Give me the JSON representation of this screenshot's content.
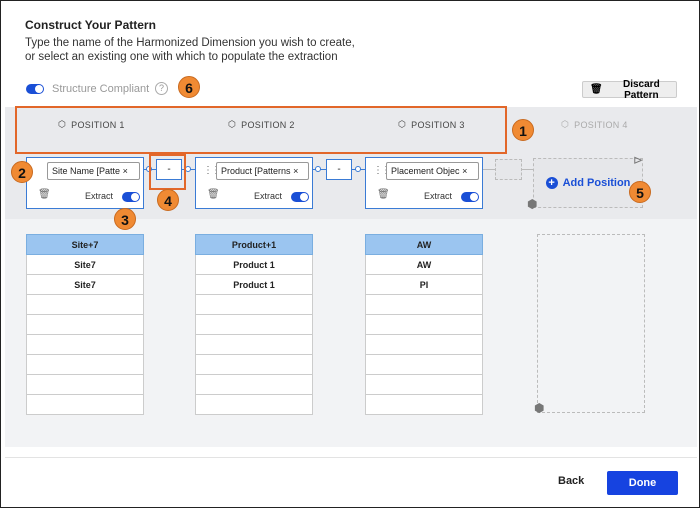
{
  "header": {
    "title": "Construct Your Pattern",
    "subtitle_line1": "Type the name of the Harmonized Dimension you wish to create,",
    "subtitle_line2": "or select an existing one with which to populate the extraction"
  },
  "structure": {
    "compliant_label": "Structure Compliant",
    "compliant_on": true,
    "help_icon_text": "?"
  },
  "discard_label": "Discard Pattern",
  "positions": [
    {
      "header": "POSITION 1",
      "tag": "Site Name [Patte",
      "extract_label": "Extract",
      "extract_on": true
    },
    {
      "header": "POSITION 2",
      "tag": "Product [Patterns",
      "extract_label": "Extract",
      "extract_on": true
    },
    {
      "header": "POSITION 3",
      "tag": "Placement Objec",
      "extract_label": "Extract",
      "extract_on": true
    },
    {
      "header": "POSITION 4"
    }
  ],
  "separators": [
    "-",
    "-"
  ],
  "add_position_label": "Add Position",
  "preview": [
    {
      "header": "Site+7",
      "rows": [
        "Site7",
        "Site7",
        "",
        "",
        "",
        "",
        "",
        ""
      ]
    },
    {
      "header": "Product+1",
      "rows": [
        "Product 1",
        "Product 1",
        "",
        "",
        "",
        "",
        "",
        ""
      ]
    },
    {
      "header": "AW",
      "rows": [
        "AW",
        "PI",
        "",
        "",
        "",
        "",
        "",
        ""
      ]
    }
  ],
  "callouts": [
    "1",
    "2",
    "3",
    "4",
    "5",
    "6"
  ],
  "footer": {
    "back_label": "Back",
    "done_label": "Done"
  },
  "colors": {
    "accent": "#1643e0",
    "callout": "#f08a33",
    "header_cell": "#9bc5f0"
  }
}
